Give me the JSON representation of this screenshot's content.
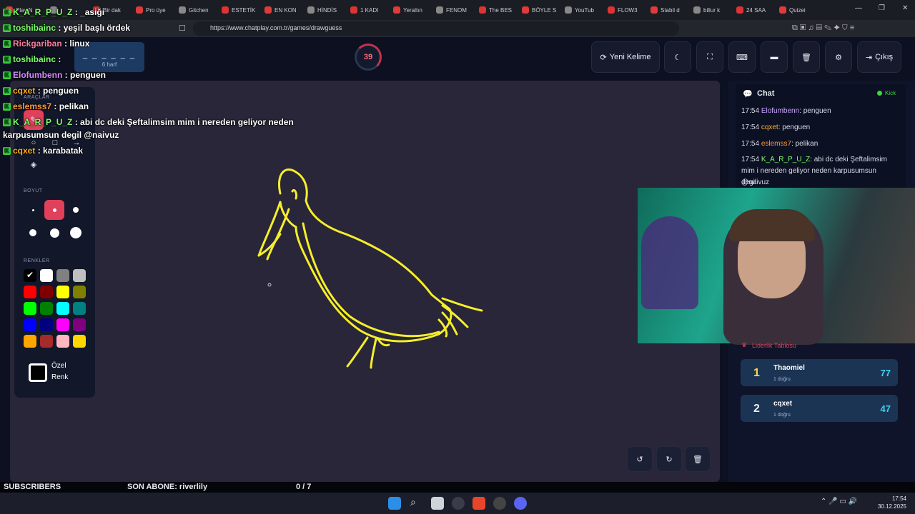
{
  "browser": {
    "tabs": [
      "Play N",
      "",
      "Bir dak",
      "Pro üye",
      "Gitchen",
      "ESTETİK",
      "EN KON",
      "HİNDİS",
      "1 KADI",
      "Yeraltın",
      "FENOM",
      "The BES",
      "BÖYLE S",
      "YouTub",
      "FLOW3",
      "Stabil d",
      "billur k",
      "24 SAA",
      "Quizei"
    ],
    "url": "https://www.chatplay.com.tr/games/drawguess"
  },
  "game": {
    "word_mask": "_ _ _ _ _ _",
    "word_hint": "6 harf",
    "timer": "39",
    "buttons": {
      "new_word": "Yeni Kelime",
      "exit": "Çıkış"
    },
    "tools_title": "ARAÇLAR",
    "size_title": "BOYUT",
    "colors_title": "RENKLER",
    "custom_color": [
      "Özel",
      "Renk"
    ]
  },
  "overlay_chat": [
    {
      "user": "K_A_R_P_U_Z",
      "msg": "_asiği",
      "color": "#7cff6b"
    },
    {
      "user": "toshibainc",
      "msg": "yeşil başlı ördek",
      "color": "#7cff6b"
    },
    {
      "user": "Rickgariban",
      "msg": "linux",
      "color": "#ff7fa0"
    },
    {
      "user": "toshibainc",
      "msg": "",
      "color": "#7cff6b"
    },
    {
      "user": "Elofumbenn",
      "msg": "penguen",
      "color": "#d88cff"
    },
    {
      "user": "cqxet",
      "msg": "penguen",
      "color": "#ffb020"
    },
    {
      "user": "eslemss7",
      "msg": "pelikan",
      "color": "#ff9a3c"
    },
    {
      "user": "K_A_R_P_U_Z",
      "msg": "abi dc deki Şeftalimsim mim i nereden geliyor neden",
      "color": "#7cff6b"
    },
    {
      "user": "",
      "msg": "karpusumsun degil  @naivuz",
      "color": "#fff"
    },
    {
      "user": "cqxet",
      "msg": "karabatak",
      "color": "#ffb020"
    }
  ],
  "chat_panel": {
    "title": "Chat",
    "source": "Kick",
    "messages": [
      {
        "time": "17:54",
        "user": "Elofumbenn",
        "msg": ": penguen",
        "color": "#c9a3ff"
      },
      {
        "time": "17:54",
        "user": "cqxet",
        "msg": ": penguen",
        "color": "#ffb020"
      },
      {
        "time": "17:54",
        "user": "eslemss7",
        "msg": ": pelikan",
        "color": "#ff9a3c"
      },
      {
        "time": "17:54",
        "user": "K_A_R_P_U_Z",
        "msg": ": abi dc deki Şeftalimsim mim i nereden geliyor neden karpusumsun degil",
        "color": "#7cff6b"
      },
      {
        "time": "",
        "user": "",
        "msg": "@naivuz",
        "color": "#fff"
      }
    ]
  },
  "leaderboard": {
    "title": "Liderlik Tablosu",
    "rows": [
      {
        "rank": "1",
        "name": "Thaomiel",
        "sub": "1 doğru",
        "score": "77"
      },
      {
        "rank": "2",
        "name": "cqxet",
        "sub": "1 doğru",
        "score": "47"
      }
    ]
  },
  "subs": {
    "label": "SUBSCRIBERS",
    "last": "SON ABONE: riverlily",
    "goal": "0 / 7"
  },
  "clock": {
    "time": "17:54",
    "date": "30.12.2025"
  },
  "colors": [
    "#000000",
    "#ffffff",
    "#808080",
    "#c0c0c0",
    "#ff0000",
    "#800000",
    "#ffff00",
    "#808000",
    "#00ff00",
    "#008000",
    "#00ffff",
    "#008080",
    "#0000ff",
    "#000080",
    "#ff00ff",
    "#800080",
    "#ffa500",
    "#a52a2a",
    "#ffb6c1",
    "#ffd700"
  ]
}
